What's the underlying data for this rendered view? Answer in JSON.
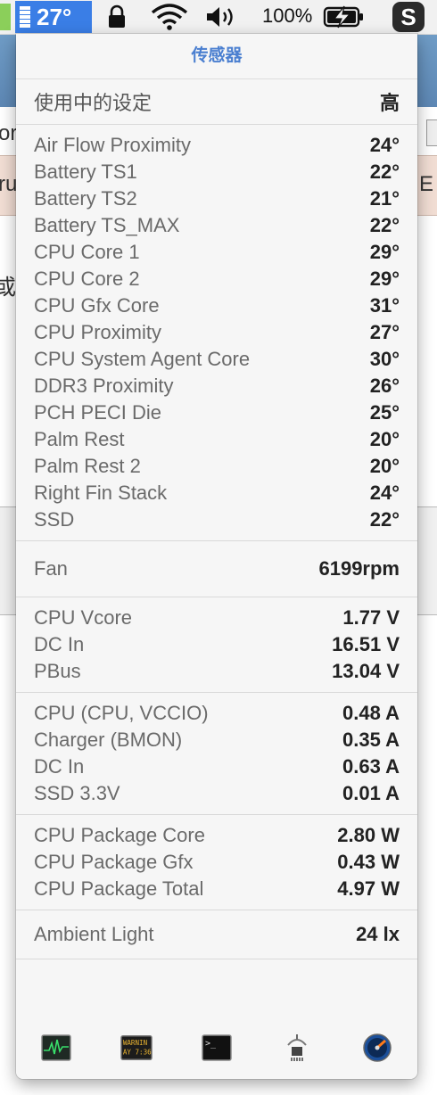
{
  "menubar": {
    "istat_temp": "27°",
    "battery_percent": "100%",
    "app_letter": "S"
  },
  "background": {
    "text_or": "or",
    "text_ru": "ru",
    "text_e": "E",
    "text_cjk": "或"
  },
  "popup": {
    "title": "传感器",
    "setting": {
      "label": "使用中的设定",
      "value": "高"
    },
    "sections": [
      {
        "name": "temperatures",
        "rows": [
          {
            "label": "Air Flow Proximity",
            "value": "24°"
          },
          {
            "label": "Battery TS1",
            "value": "22°"
          },
          {
            "label": "Battery TS2",
            "value": "21°"
          },
          {
            "label": "Battery TS_MAX",
            "value": "22°"
          },
          {
            "label": "CPU Core 1",
            "value": "29°"
          },
          {
            "label": "CPU Core 2",
            "value": "29°"
          },
          {
            "label": "CPU Gfx Core",
            "value": "31°"
          },
          {
            "label": "CPU Proximity",
            "value": "27°"
          },
          {
            "label": "CPU System Agent Core",
            "value": "30°"
          },
          {
            "label": "DDR3 Proximity",
            "value": "26°"
          },
          {
            "label": "PCH PECI Die",
            "value": "25°"
          },
          {
            "label": "Palm Rest",
            "value": "20°"
          },
          {
            "label": "Palm Rest 2",
            "value": "20°"
          },
          {
            "label": "Right Fin Stack",
            "value": "24°"
          },
          {
            "label": "SSD",
            "value": "22°"
          }
        ]
      },
      {
        "name": "fans",
        "rows": [
          {
            "label": "Fan",
            "value": "6199rpm"
          }
        ]
      },
      {
        "name": "voltages",
        "rows": [
          {
            "label": "CPU Vcore",
            "value": "1.77 V"
          },
          {
            "label": "DC In",
            "value": "16.51 V"
          },
          {
            "label": "PBus",
            "value": "13.04 V"
          }
        ]
      },
      {
        "name": "currents",
        "rows": [
          {
            "label": "CPU (CPU, VCCIO)",
            "value": "0.48 A"
          },
          {
            "label": "Charger (BMON)",
            "value": "0.35 A"
          },
          {
            "label": "DC In",
            "value": "0.63 A"
          },
          {
            "label": "SSD 3.3V",
            "value": "0.01 A"
          }
        ]
      },
      {
        "name": "power",
        "rows": [
          {
            "label": "CPU Package Core",
            "value": "2.80 W"
          },
          {
            "label": "CPU Package Gfx",
            "value": "0.43 W"
          },
          {
            "label": "CPU Package Total",
            "value": "4.97 W"
          }
        ]
      },
      {
        "name": "light",
        "rows": [
          {
            "label": "Ambient Light",
            "value": "24 lx"
          }
        ]
      }
    ],
    "bottom_icons": [
      {
        "name": "activity-monitor-icon"
      },
      {
        "name": "console-icon",
        "text": "WARNIN\nAY 7:36"
      },
      {
        "name": "terminal-icon",
        "text": ">_"
      },
      {
        "name": "system-information-icon"
      },
      {
        "name": "disk-utility-icon"
      }
    ]
  },
  "colors": {
    "accent": "#3a7ee6",
    "title": "#4a7fd0",
    "label": "#6a6a6a",
    "value": "#222222"
  }
}
